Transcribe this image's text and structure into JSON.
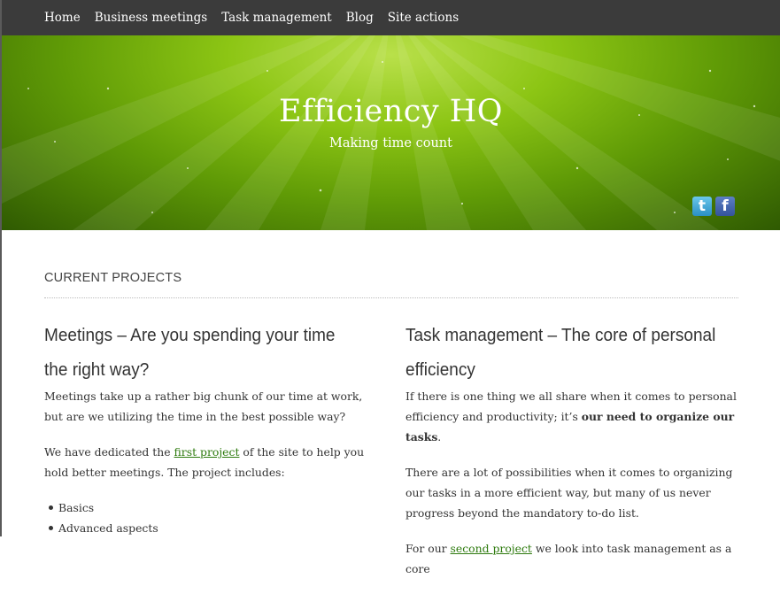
{
  "nav": {
    "items": [
      "Home",
      "Business meetings",
      "Task management",
      "Blog",
      "Site actions"
    ]
  },
  "header": {
    "title": "Efficiency HQ",
    "tagline": "Making time count",
    "social": [
      {
        "name": "twitter",
        "glyph": "t"
      },
      {
        "name": "facebook",
        "glyph": "f"
      }
    ]
  },
  "section": {
    "title": "CURRENT PROJECTS"
  },
  "projects": {
    "left": {
      "heading": "Meetings – Are you spending your time the right way?",
      "p1": "Meetings take up a rather big chunk of our time at work, but are we utilizing the time in the best possible way?",
      "p2_before": "We have dedicated the ",
      "p2_link": "first project",
      "p2_after": " of the site to help you hold better meetings. The project includes:",
      "list": [
        "Basics",
        "Advanced aspects"
      ]
    },
    "right": {
      "heading": "Task management – The core of personal efficiency",
      "p1_before": "If there is one thing we all share when it comes to personal efficiency and productivity; it’s ",
      "p1_bold": "our need to organize our tasks",
      "p1_after": ".",
      "p2": "There are a lot of possibilities when it comes to organizing our tasks in a more efficient way, but many of us never progress beyond the mandatory to-do list.",
      "p3_before": "For our ",
      "p3_link": "second project",
      "p3_after": " we look into task management as a core"
    }
  },
  "colors": {
    "nav_bg": "#3b3b3b",
    "header_green": "#8cc514",
    "link": "#2d7a0d"
  }
}
